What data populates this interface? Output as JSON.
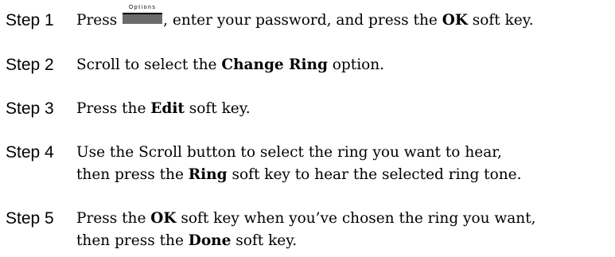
{
  "steps": [
    {
      "label": "Step 1",
      "pre": "Press ",
      "key_caption": "Options",
      "mid": ", enter your password, and press the ",
      "bold1": "OK",
      "post": " soft key."
    },
    {
      "label": "Step 2",
      "pre": "Scroll to select the ",
      "bold1": "Change Ring",
      "post": " option."
    },
    {
      "label": "Step 3",
      "pre": "Press the ",
      "bold1": "Edit",
      "post": " soft key."
    },
    {
      "label": "Step 4",
      "line1": "Use the Scroll button to select the ring you want to hear,",
      "pre2": "then press the ",
      "bold1": "Ring",
      "post2": " soft key to hear the selected ring tone."
    },
    {
      "label": "Step 5",
      "pre1": "Press the ",
      "bold1": "OK",
      "post1": " soft key when you’ve chosen the ring you want,",
      "pre2": "then press the ",
      "bold2": "Done",
      "post2": " soft key."
    }
  ]
}
